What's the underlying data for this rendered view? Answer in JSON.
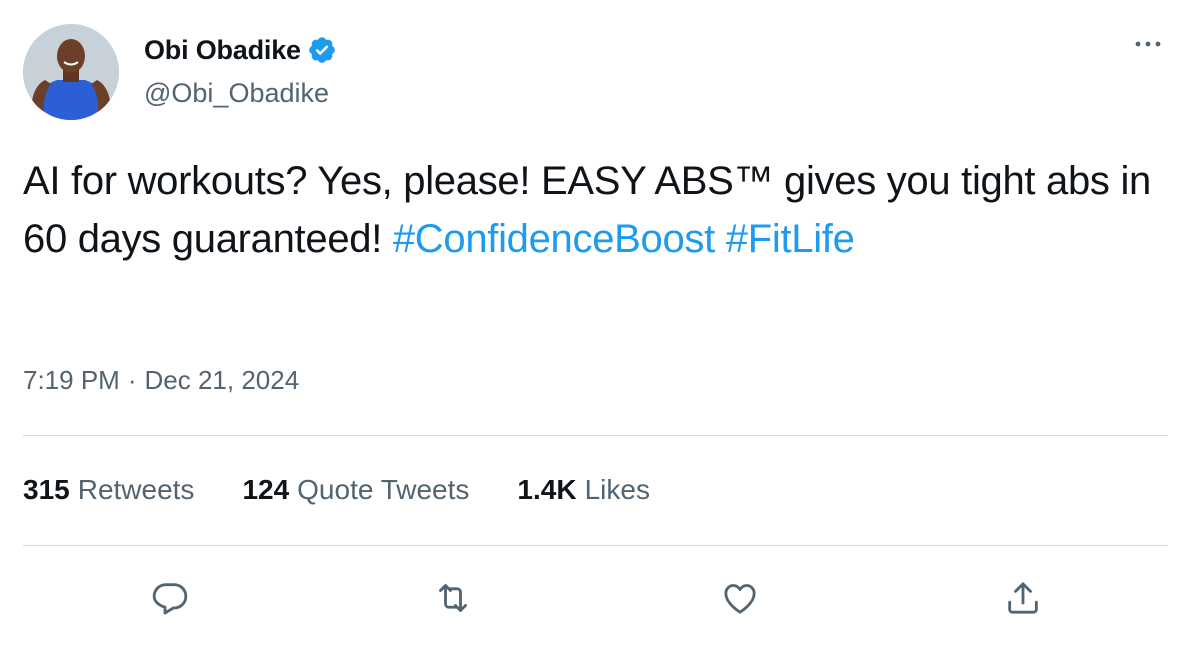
{
  "author": {
    "display_name": "Obi Obadike",
    "handle": "@Obi_Obadike",
    "verified": true
  },
  "tweet": {
    "text_parts": [
      "AI for workouts? Yes, please! EASY ABS™ gives you tight abs in 60 days guaranteed! ",
      "#ConfidenceBoost",
      " ",
      "#FitLife"
    ],
    "time": "7:19 PM",
    "separator": "·",
    "date": "Dec 21, 2024"
  },
  "stats": {
    "retweets": {
      "count": "315",
      "label": "Retweets"
    },
    "quote_tweets": {
      "count": "124",
      "label": "Quote Tweets"
    },
    "likes": {
      "count": "1.4K",
      "label": "Likes"
    }
  },
  "icons": {
    "more": "more-icon",
    "reply": "reply-icon",
    "retweet": "retweet-icon",
    "like": "heart-icon",
    "share": "share-icon",
    "verified": "verified-badge-icon"
  },
  "colors": {
    "accent": "#1d9bf0",
    "text": "#0f1419",
    "secondary": "#536471",
    "divider": "#cfd9de"
  }
}
